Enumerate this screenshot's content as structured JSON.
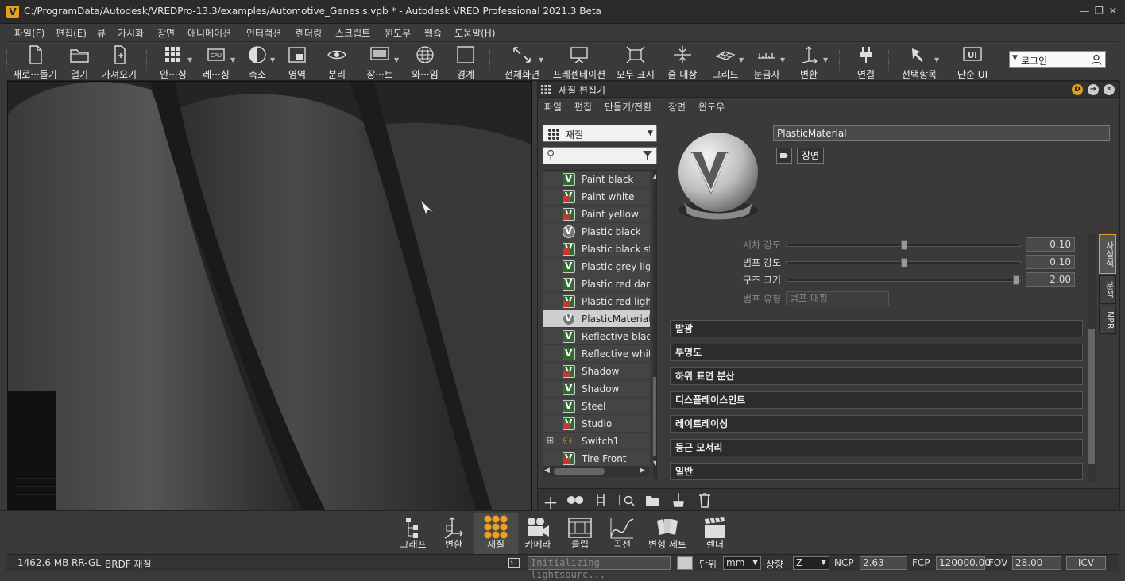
{
  "window": {
    "title": "C:/ProgramData/Autodesk/VREDPro-13.3/examples/Automotive_Genesis.vpb * - Autodesk VRED Professional 2021.3 Beta",
    "logo": "V"
  },
  "menubar": [
    "파일(F)",
    "편집(E)",
    "뷰",
    "가시화",
    "장면",
    "애니메이션",
    "인터랙션",
    "렌더링",
    "스크립트",
    "윈도우",
    "웹숍",
    "도움말(H)"
  ],
  "toolbar": {
    "items": [
      "새로···들기",
      "열기",
      "가져오기",
      "안···싱",
      "레···싱",
      "축소",
      "영역",
      "분리",
      "장···트",
      "와···임",
      "경계",
      "전체화면",
      "프레젠테이션",
      "모두 표시",
      "줌 대상",
      "그리드",
      "눈금자",
      "변환",
      "연결",
      "선택항목",
      "단순 UI"
    ]
  },
  "login": {
    "label": "로그인"
  },
  "panel": {
    "title": "재질 편집기",
    "menu": [
      "파일",
      "편집",
      "만들기/전환",
      "장면",
      "윈도우"
    ],
    "dropdown": "재질",
    "materials": [
      {
        "name": "Paint black",
        "icon": "green"
      },
      {
        "name": "Paint white",
        "icon": "red"
      },
      {
        "name": "Paint yellow",
        "icon": "red"
      },
      {
        "name": "Plastic black",
        "icon": "round"
      },
      {
        "name": "Plastic black st",
        "icon": "red"
      },
      {
        "name": "Plastic grey ligl",
        "icon": "green"
      },
      {
        "name": "Plastic red dark",
        "icon": "green"
      },
      {
        "name": "Plastic red ligh",
        "icon": "red"
      },
      {
        "name": "PlasticMaterial",
        "icon": "round",
        "selected": true
      },
      {
        "name": "Reflective black",
        "icon": "green"
      },
      {
        "name": "Reflective white",
        "icon": "green"
      },
      {
        "name": "Shadow",
        "icon": "red"
      },
      {
        "name": "Shadow",
        "icon": "green"
      },
      {
        "name": "Steel",
        "icon": "green"
      },
      {
        "name": "Studio",
        "icon": "red"
      },
      {
        "name": "Switch1",
        "icon": "switch"
      },
      {
        "name": "Tire Front",
        "icon": "red"
      }
    ],
    "material_name": "PlasticMaterial",
    "scene_button": "장면",
    "props": [
      {
        "label": "시차 강도",
        "value": "0.10",
        "level": 0.5,
        "dim": true
      },
      {
        "label": "범프 강도",
        "value": "0.10",
        "level": 0.5,
        "dim": false
      },
      {
        "label": "구조 크기",
        "value": "2.00",
        "level": 0.99,
        "dim": false
      }
    ],
    "bump_type": {
      "label": "범프 유형",
      "value": "범프 매핑"
    },
    "sections": [
      "발광",
      "투명도",
      "하위 표면 분산",
      "디스플레이스먼트",
      "레이트레이싱",
      "둥근 모서리",
      "일반"
    ],
    "tabs": [
      "사실적",
      "분석",
      "NPR"
    ]
  },
  "modes": [
    "그래프",
    "변환",
    "재질",
    "카메라",
    "클립",
    "곡선",
    "변형 세트",
    "렌더"
  ],
  "status": {
    "memory": "1462.6 MB",
    "renderer": "RR-GL",
    "mode": "BRDF 재질",
    "message": "Initializing lightsourc...",
    "unit_label": "단위",
    "unit": "mm",
    "up_label": "상향",
    "up": "Z",
    "ncp_label": "NCP",
    "ncp": "2.63",
    "fcp_label": "FCP",
    "fcp": "120000.00",
    "fov_label": "FOV",
    "fov": "28.00",
    "icv": "ICV"
  }
}
